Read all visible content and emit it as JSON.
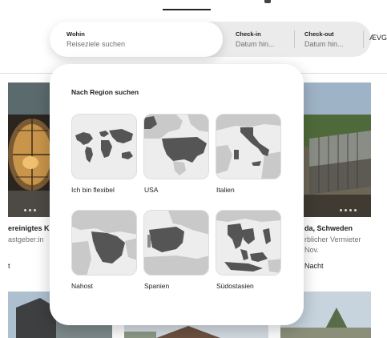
{
  "search": {
    "where_label": "Wohin",
    "where_placeholder": "Reiseziele suchen",
    "checkin_label": "Check-in",
    "checkin_value": "Datum hin...",
    "checkout_label": "Check-out",
    "checkout_value": "Datum hin...",
    "cut_text": "ÆVG"
  },
  "background": {
    "left_title": "ereinigtes K",
    "left_host": "astgeber:in",
    "left_price": "t",
    "right_title": "da, Schweden",
    "right_host": "rblicher Vermieter",
    "right_date": "Nov.",
    "right_price": "Nacht"
  },
  "panel": {
    "title": "Nach Region suchen",
    "regions": [
      {
        "label": "Ich bin flexibel",
        "icon": "world-map-icon"
      },
      {
        "label": "USA",
        "icon": "usa-map-icon"
      },
      {
        "label": "Italien",
        "icon": "italy-map-icon"
      },
      {
        "label": "Nahost",
        "icon": "middle-east-map-icon"
      },
      {
        "label": "Spanien",
        "icon": "spain-map-icon"
      },
      {
        "label": "Südostasien",
        "icon": "southeast-asia-map-icon"
      }
    ]
  },
  "colors": {
    "land": "#bdbdbd",
    "highlight": "#555555",
    "sea": "#ececec"
  }
}
